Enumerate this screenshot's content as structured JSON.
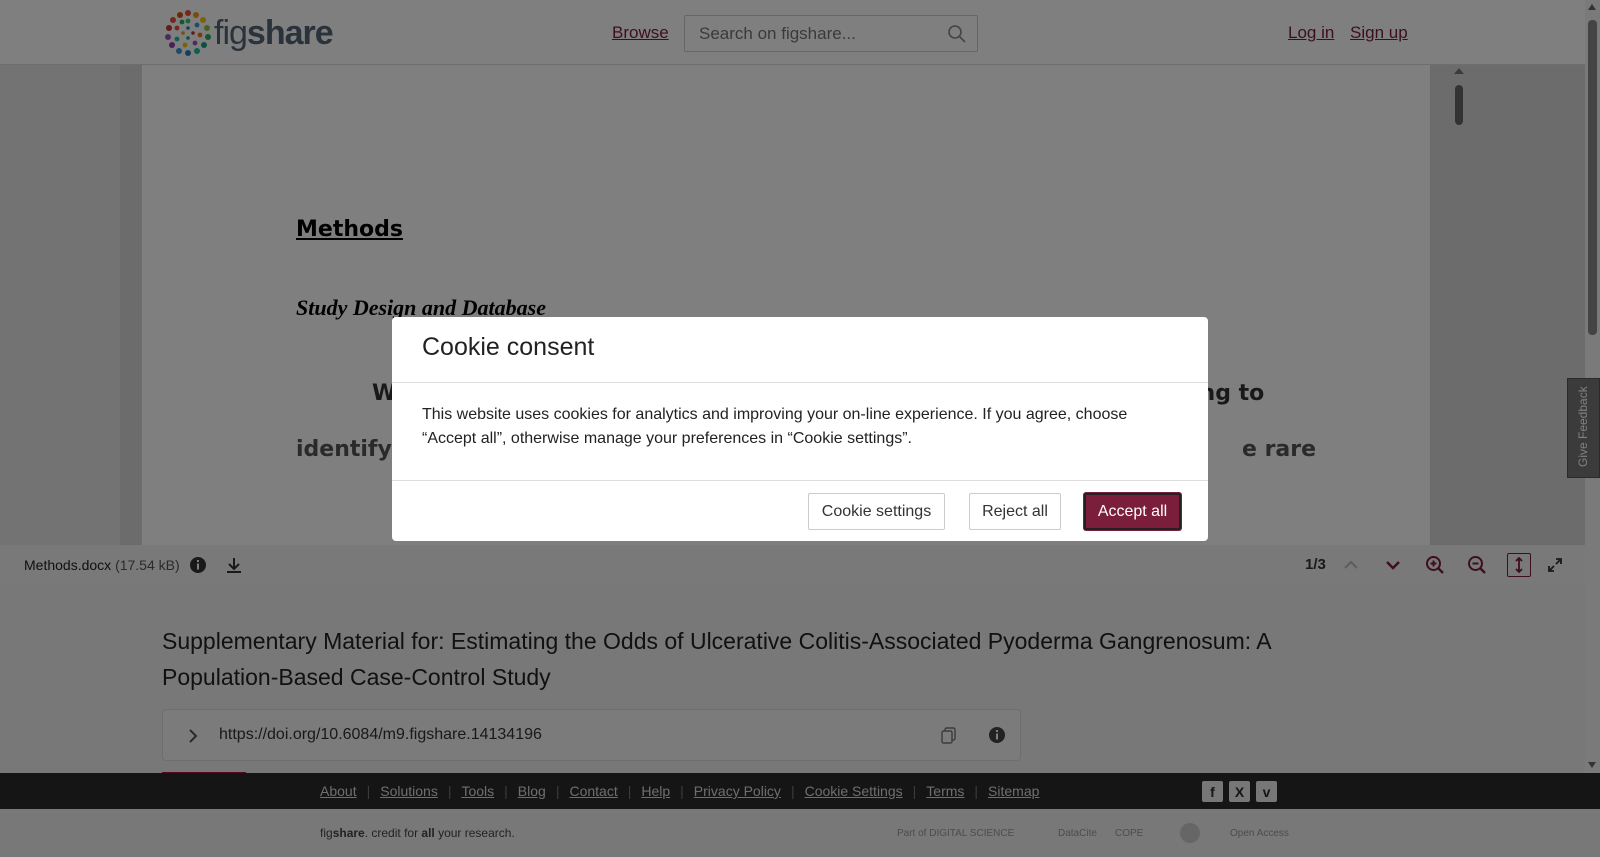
{
  "header": {
    "logo_fig": "fig",
    "logo_share": "share",
    "browse": "Browse",
    "search_placeholder": "Search on figshare...",
    "login": "Log in",
    "signup": "Sign up"
  },
  "document": {
    "heading": "Methods",
    "subheading": "Study Design and Database",
    "line1_start": "W",
    "line1_end": "ing to",
    "line2_start": "identify",
    "line2_end": "e rare"
  },
  "toolbar": {
    "file_name": "Methods.docx",
    "file_size": "(17.54 kB)",
    "page_indicator": "1/3"
  },
  "item": {
    "title": "Supplementary Material for: Estimating the Odds of Ulcerative Colitis-Associated Pyoderma Gangrenosum: A Population-Based Case-Control Study",
    "doi": "https://doi.org/10.6084/m9.figshare.14134196"
  },
  "feedback": "Give Feedback",
  "modal": {
    "title": "Cookie consent",
    "body": "This website uses cookies for analytics and improving your on-line experience. If you agree, choose “Accept all”, otherwise manage your preferences in “Cookie settings”.",
    "settings_button": "Cookie settings",
    "reject_button": "Reject all",
    "accept_button": "Accept all"
  },
  "footer": {
    "links": [
      "About",
      "Solutions",
      "Tools",
      "Blog",
      "Contact",
      "Help",
      "Privacy Policy",
      "Cookie Settings",
      "Terms",
      "Sitemap"
    ],
    "tagline_fig": "fig",
    "tagline_share": "share",
    "tagline_mid": ". credit for ",
    "tagline_all": "all",
    "tagline_end": " your research.",
    "partners": [
      "Part of DIGITAL SCIENCE",
      "DataCite",
      "COPE",
      "",
      "Open Access"
    ]
  },
  "colors": {
    "brand": "#7a1e3c",
    "accent_red": "#b3123c"
  }
}
